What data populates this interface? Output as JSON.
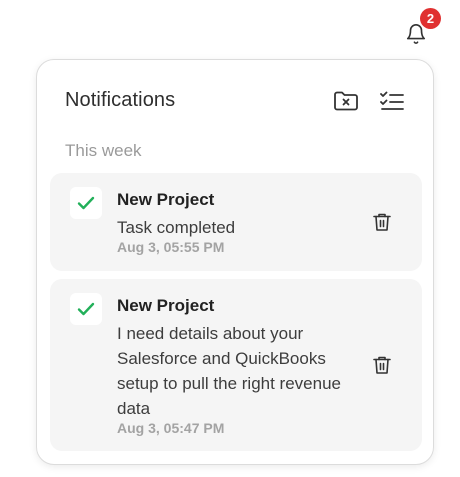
{
  "header": {
    "bell_icon": "bell-icon",
    "badge_count": "2",
    "badge_color": "#e03131"
  },
  "panel": {
    "title": "Notifications",
    "actions": [
      {
        "icon": "folder-x-icon"
      },
      {
        "icon": "list-check-icon"
      }
    ],
    "section_label": "This week",
    "notifications": [
      {
        "title": "New Project",
        "body": "Task completed",
        "time": "Aug 3, 05:55 PM",
        "status_icon": "check-icon",
        "action_icon": "trash-icon"
      },
      {
        "title": "New Project",
        "body": "I need details about your Salesforce and QuickBooks setup to pull the right revenue data",
        "time": "Aug 3, 05:47 PM",
        "status_icon": "check-icon",
        "action_icon": "trash-icon"
      }
    ]
  },
  "colors": {
    "check": "#22b05a",
    "card_bg": "#f5f5f5",
    "muted_text": "#9a9a9a"
  }
}
